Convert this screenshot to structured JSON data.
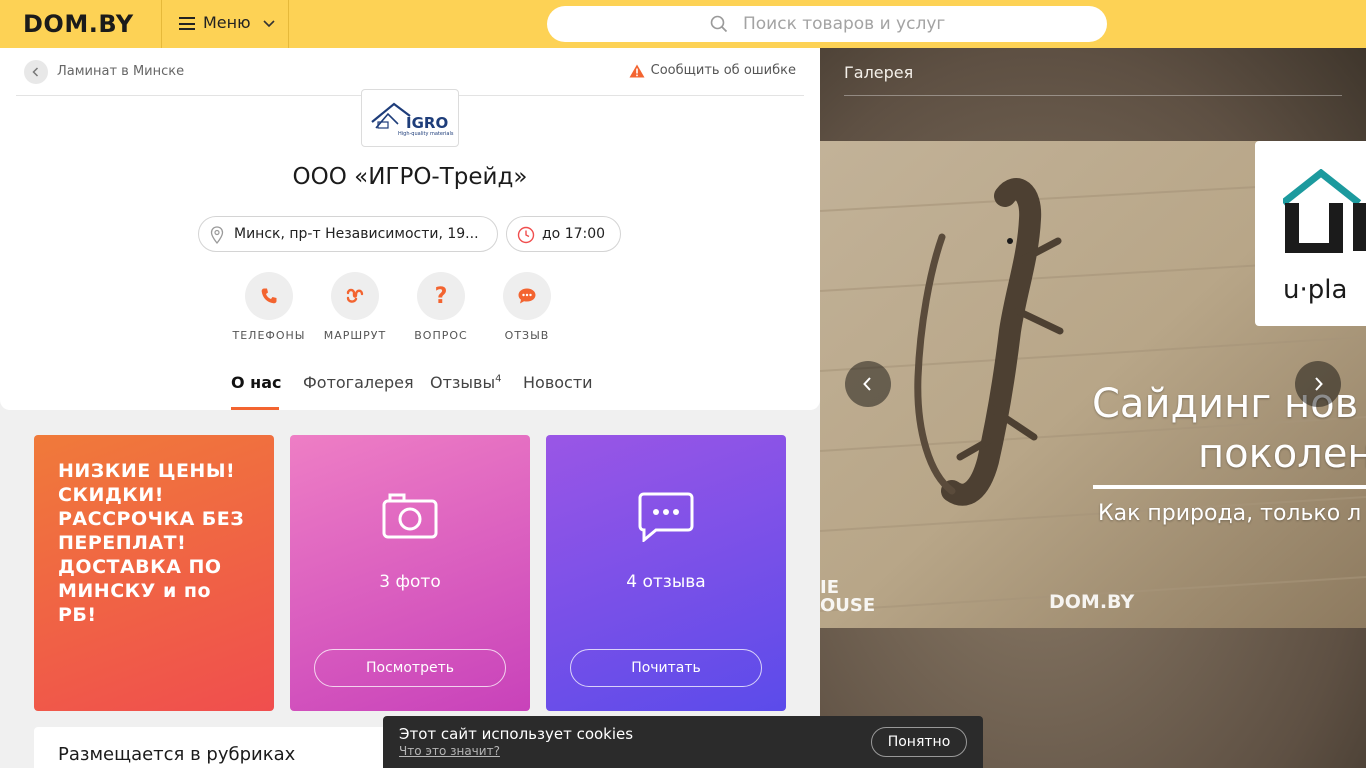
{
  "header": {
    "logo": "DOM.BY",
    "menu_label": "Меню",
    "search_placeholder": "Поиск товаров и услуг"
  },
  "breadcrumb": {
    "label": "Ламинат в Минске"
  },
  "report_error": "Сообщить об ошибке",
  "company": {
    "logo_text": "IGRO",
    "logo_tagline": "High-quality materials",
    "name": "ООО «ИГРО-Трейд»",
    "address": "Минск, пр-т Независимости, 19...",
    "hours": "до 17:00"
  },
  "actions": [
    {
      "label": "ТЕЛЕФОНЫ",
      "icon": "phone-icon"
    },
    {
      "label": "МАРШРУТ",
      "icon": "route-icon"
    },
    {
      "label": "ВОПРОС",
      "icon": "question-icon"
    },
    {
      "label": "ОТЗЫВ",
      "icon": "chat-icon"
    }
  ],
  "tabs": {
    "about": "О нас",
    "gallery": "Фотогалерея",
    "reviews": "Отзывы",
    "reviews_count": "4",
    "news": "Новости"
  },
  "tiles": {
    "promo": "НИЗКИЕ ЦЕНЫ! СКИДКИ! РАССРОЧКА БЕЗ ПЕРЕПЛАТ! ДОСТАВКА ПО МИНСКУ и по РБ!",
    "photos_count": "3 фото",
    "photos_button": "Посмотреть",
    "reviews_count": "4 отзыва",
    "reviews_button": "Почитать"
  },
  "rubrics_title": "Размещается в рубриках",
  "gallery": {
    "title": "Галерея",
    "slide_heading_1": "Сайдинг нов",
    "slide_heading_2": "поколен",
    "slide_subtitle": "Как природа, только л",
    "brand_fragment": "U",
    "brand_fragment_2": "u·pla",
    "watermark_left_1": "IE",
    "watermark_left_2": "OUSE",
    "watermark_dom": "DOM.BY"
  },
  "cookie": {
    "text": "Этот сайт использует cookies",
    "link": "Что это значит?",
    "button": "Понятно"
  },
  "colors": {
    "header_bg": "#fdd255",
    "accent": "#f36430",
    "promo_tile": "#f04e4e",
    "photo_tile": "#d455bd",
    "reviews_tile": "#6e4fe8"
  }
}
